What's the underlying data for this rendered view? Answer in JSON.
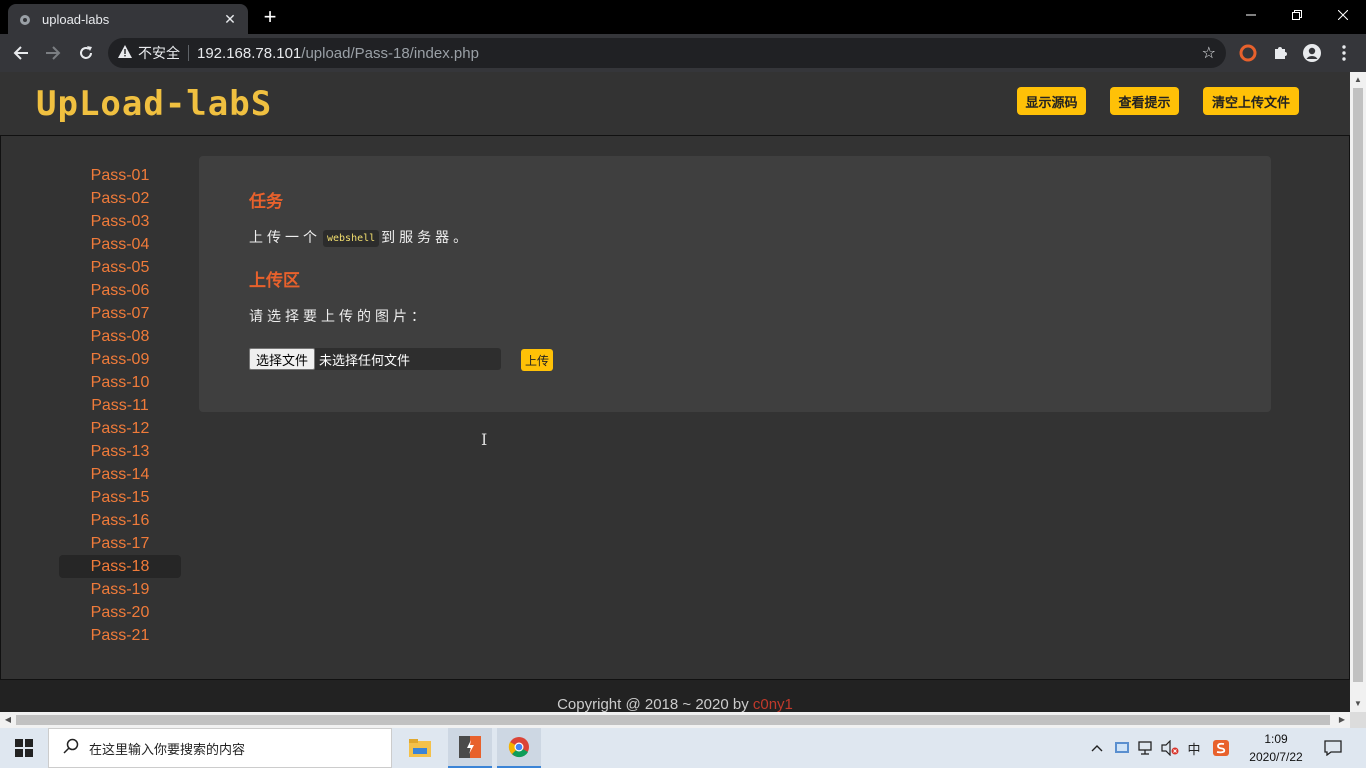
{
  "browser": {
    "tab_title": "upload-labs",
    "tab_close": "✕",
    "new_tab": "+",
    "url_security_label": "不安全",
    "url_host": "192.168.78.101",
    "url_path": "/upload/Pass-18/index.php",
    "icons": [
      "back-icon",
      "forward-icon",
      "reload-icon",
      "warning-icon",
      "star-icon",
      "extension-icon",
      "puzzle-icon",
      "profile-icon",
      "menu-icon"
    ]
  },
  "page": {
    "logo_text": "UpLoad-labS",
    "header_buttons": [
      "显示源码",
      "查看提示",
      "清空上传文件"
    ],
    "passes": [
      "Pass-01",
      "Pass-02",
      "Pass-03",
      "Pass-04",
      "Pass-05",
      "Pass-06",
      "Pass-07",
      "Pass-08",
      "Pass-09",
      "Pass-10",
      "Pass-11",
      "Pass-12",
      "Pass-13",
      "Pass-14",
      "Pass-15",
      "Pass-16",
      "Pass-17",
      "Pass-18",
      "Pass-19",
      "Pass-20",
      "Pass-21"
    ],
    "active_pass": "Pass-18",
    "task_heading": "任务",
    "task_prefix": "上传一个",
    "task_code": "webshell",
    "task_suffix": "到服务器。",
    "upload_heading": "上传区",
    "upload_prompt": "请选择要上传的图片：",
    "file_button": "选择文件",
    "file_status": "未选择任何文件",
    "upload_button": "上传",
    "footer_prefix": "Copyright @ 2018 ~ 2020 by",
    "footer_author": "c0ny1",
    "accent_color": "#ffc107",
    "link_color": "#f07b3a",
    "heading_color": "#e8612c"
  },
  "taskbar": {
    "search_placeholder": "在这里输入你要搜索的内容",
    "ime_label": "中",
    "time": "1:09",
    "date": "2020/7/22"
  }
}
